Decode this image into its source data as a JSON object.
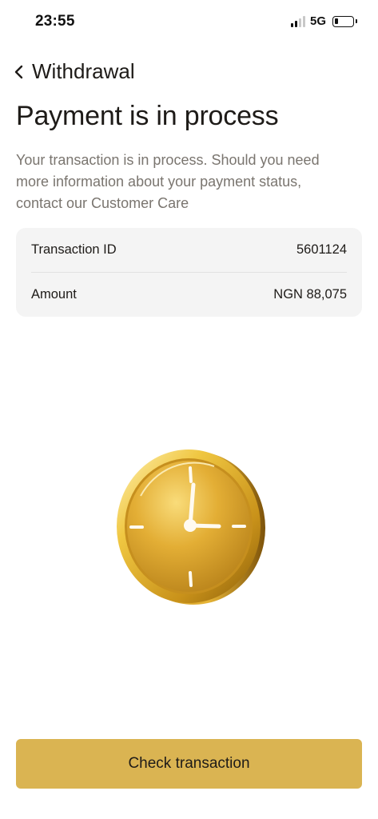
{
  "status_bar": {
    "time": "23:55",
    "network": "5G"
  },
  "nav": {
    "back_icon": "chevron-left-icon",
    "title": "Withdrawal"
  },
  "main": {
    "title": "Payment is in process",
    "description": "Your transaction is in process. Should you need more information about your payment status, contact our Customer Care"
  },
  "details": {
    "transaction_id_label": "Transaction ID",
    "transaction_id_value": "5601124",
    "amount_label": "Amount",
    "amount_value": "NGN 88,075"
  },
  "illustration": {
    "icon": "gold-clock-icon"
  },
  "actions": {
    "check_label": "Check transaction"
  },
  "colors": {
    "accent": "#dab452",
    "card_bg": "#f4f4f4",
    "muted_text": "#7a756f"
  }
}
